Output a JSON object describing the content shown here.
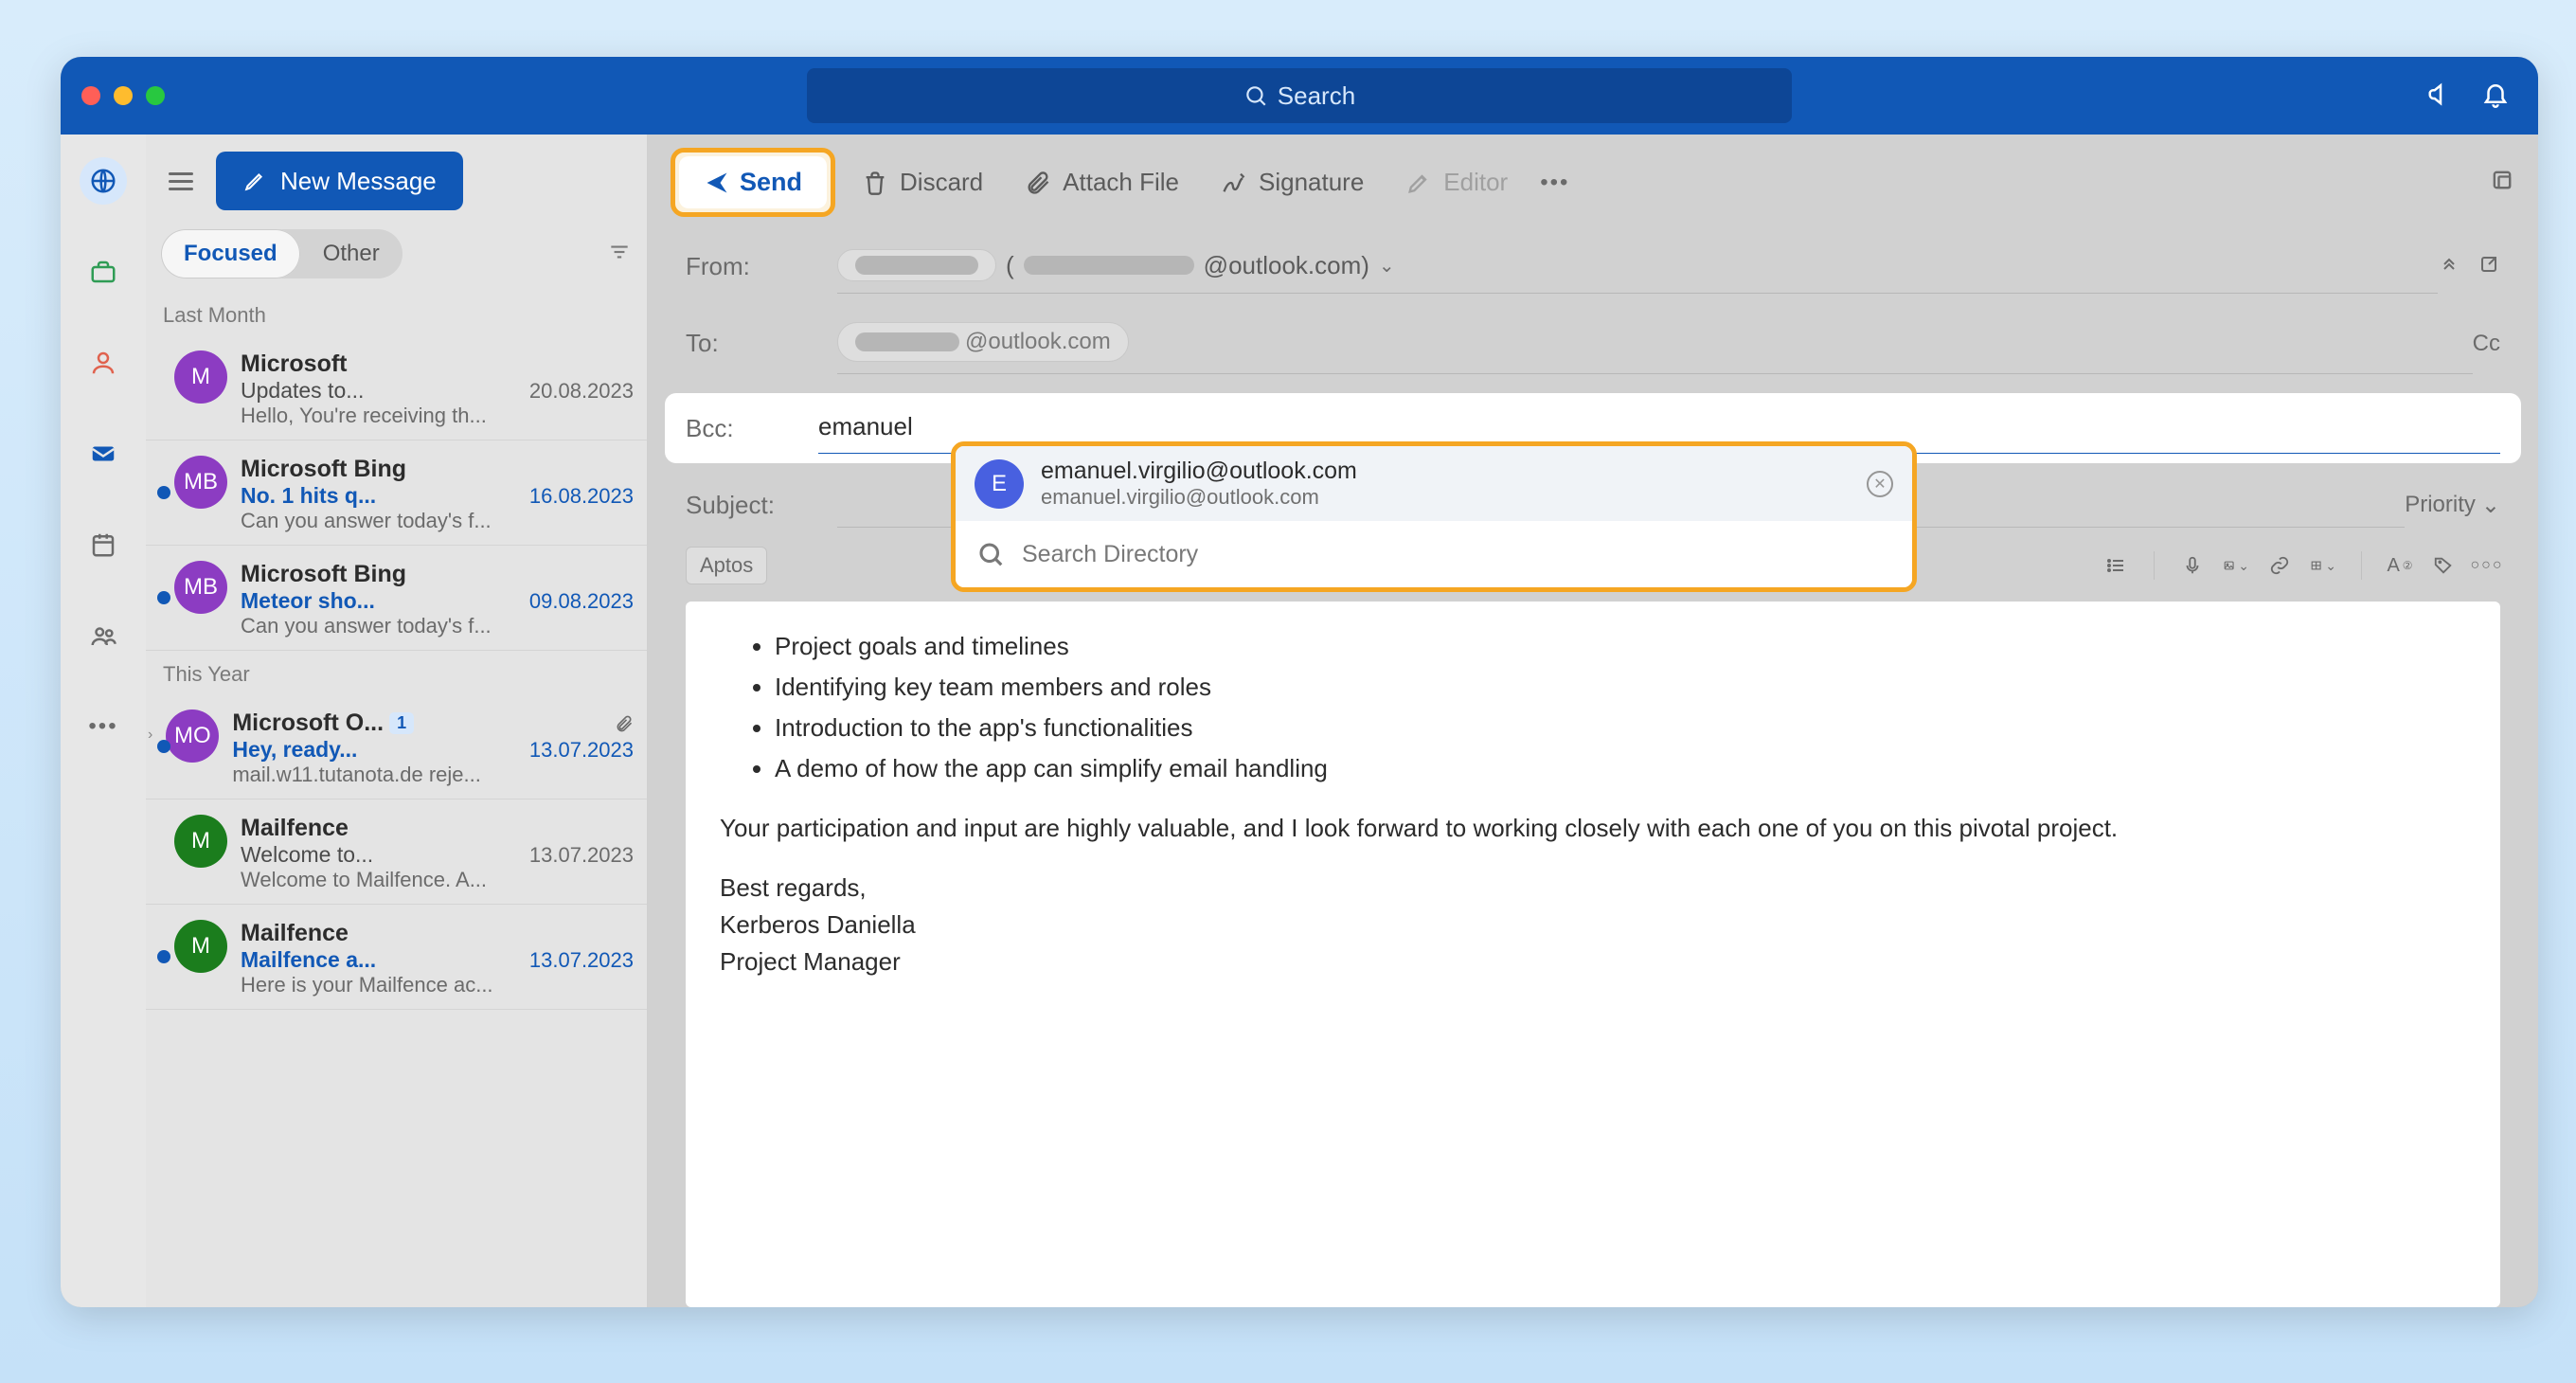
{
  "titlebar": {
    "search_placeholder": "Search"
  },
  "sidebar": {
    "new_message": "New Message",
    "tabs": {
      "focused": "Focused",
      "other": "Other"
    },
    "groups": [
      {
        "label": "Last Month",
        "items": [
          {
            "sender": "Microsoft",
            "initials": "M",
            "color": "#8c3cc2",
            "subject": "Updates to...",
            "date": "20.08.2023",
            "preview": "Hello, You're receiving th...",
            "unread": false
          },
          {
            "sender": "Microsoft Bing",
            "initials": "MB",
            "color": "#8c3cc2",
            "subject": "No. 1 hits q...",
            "date": "16.08.2023",
            "preview": "Can you answer today's f...",
            "unread": true
          },
          {
            "sender": "Microsoft Bing",
            "initials": "MB",
            "color": "#8c3cc2",
            "subject": "Meteor sho...",
            "date": "09.08.2023",
            "preview": "Can you answer today's f...",
            "unread": true
          }
        ]
      },
      {
        "label": "This Year",
        "items": [
          {
            "sender": "Microsoft O...",
            "initials": "MO",
            "color": "#8c3cc2",
            "subject": "Hey, ready...",
            "date": "13.07.2023",
            "preview": "mail.w11.tutanota.de reje...",
            "unread": true,
            "badge": "1",
            "attachment": true,
            "chevron": true
          },
          {
            "sender": "Mailfence",
            "initials": "M",
            "color": "#1b7d1d",
            "subject": "Welcome to...",
            "date": "13.07.2023",
            "preview": "Welcome to Mailfence. A...",
            "unread": false
          },
          {
            "sender": "Mailfence",
            "initials": "M",
            "color": "#1b7d1d",
            "subject": "Mailfence a...",
            "date": "13.07.2023",
            "preview": "Here is your Mailfence ac...",
            "unread": true
          }
        ]
      }
    ]
  },
  "toolbar": {
    "send": "Send",
    "discard": "Discard",
    "attach": "Attach File",
    "signature": "Signature",
    "editor": "Editor"
  },
  "compose": {
    "from_label": "From:",
    "to_label": "To:",
    "bcc_label": "Bcc:",
    "subject_label": "Subject:",
    "cc_label": "Cc",
    "priority_label": "Priority",
    "from_domain": "@outlook.com)",
    "to_domain": "@outlook.com",
    "bcc_value": "emanuel",
    "font_name": "Aptos"
  },
  "suggestion": {
    "initial": "E",
    "name": "emanuel.virgilio@outlook.com",
    "sub": "emanuel.virgilio@outlook.com",
    "search_dir": "Search Directory"
  },
  "body": {
    "bullets": [
      "Project goals and timelines",
      "Identifying key team members and roles",
      "Introduction to the app's functionalities",
      "A demo of how the app can simplify email handling"
    ],
    "para": "Your participation and input are highly valuable, and I look forward to working closely with each one of you on this pivotal project.",
    "regards": "Best regards,",
    "name": "Kerberos Daniella",
    "title": "Project Manager"
  }
}
